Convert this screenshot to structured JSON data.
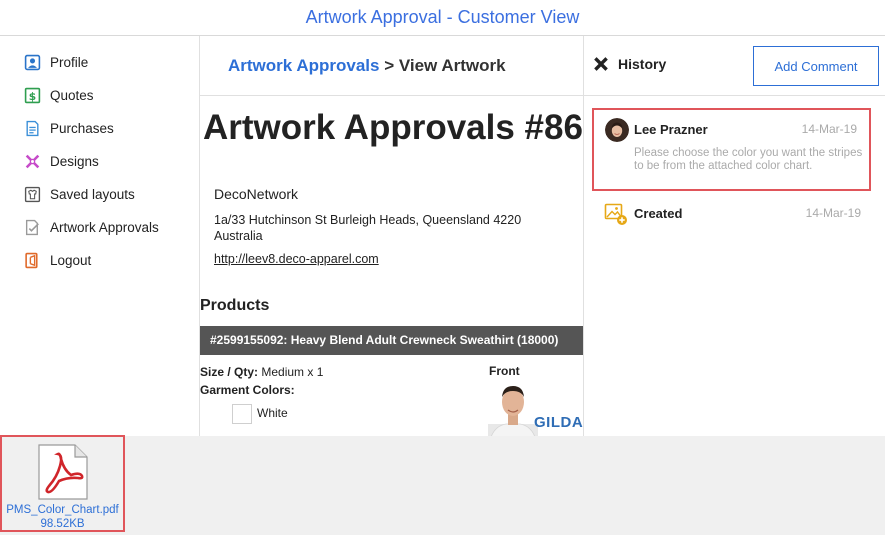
{
  "banner": {
    "title": "Artwork Approval - Customer View"
  },
  "sidebar": {
    "items": [
      {
        "label": "Profile",
        "icon": "profile-icon"
      },
      {
        "label": "Quotes",
        "icon": "quotes-icon"
      },
      {
        "label": "Purchases",
        "icon": "purchases-icon"
      },
      {
        "label": "Designs",
        "icon": "designs-icon"
      },
      {
        "label": "Saved layouts",
        "icon": "saved-layouts-icon"
      },
      {
        "label": "Artwork Approvals",
        "icon": "artwork-approvals-icon"
      },
      {
        "label": "Logout",
        "icon": "logout-icon"
      }
    ]
  },
  "main": {
    "breadcrumb": {
      "link": "Artwork Approvals",
      "separator": " > ",
      "current": "View Artwork"
    },
    "title": "Artwork Approvals #86",
    "company": "DecoNetwork",
    "address": "1a/33 Hutchinson St Burleigh Heads, Queensland 4220 Australia",
    "url": "http://leev8.deco-apparel.com",
    "products_heading": "Products",
    "product": {
      "header": "#2599155092: Heavy Blend Adult Crewneck Sweathirt (18000)",
      "size_qty_label": "Size / Qty:",
      "size_qty_value": "Medium x 1",
      "garment_colors_label": "Garment Colors:",
      "colors": [
        "White"
      ],
      "view_label": "Front",
      "brand": "GILDA"
    }
  },
  "history": {
    "title": "History",
    "add_comment_label": "Add Comment",
    "entries": [
      {
        "author": "Lee Prazner",
        "date": "14-Mar-19",
        "comment": "Please choose the color you want the stripes to be from the attached color chart."
      },
      {
        "event": "Created",
        "date": "14-Mar-19",
        "icon": "image-add-icon"
      }
    ]
  },
  "attachment": {
    "filename": "PMS_Color_Chart.pdf",
    "size": "98.52KB",
    "icon": "pdf-icon"
  },
  "colors": {
    "accent": "#2d6fd6",
    "highlight": "#e0555a",
    "product_bar": "#555555"
  }
}
